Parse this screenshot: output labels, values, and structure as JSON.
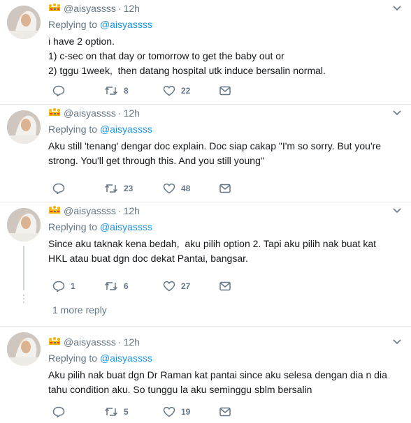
{
  "tweets": [
    {
      "handle": "@aisyassss",
      "time": "12h",
      "replying_prefix": "Replying to",
      "replying_to": "@aisyassss",
      "text": "i have 2 option.\n1) c-sec on that day or tomorrow to get the baby out or\n2) tggu 1week,  then datang hospital utk induce bersalin normal.",
      "replies": "",
      "retweets": "8",
      "likes": "22"
    },
    {
      "handle": "@aisyassss",
      "time": "12h",
      "replying_prefix": "Replying to",
      "replying_to": "@aisyassss",
      "text": "Aku still 'tenang' dengar doc explain. Doc siap cakap \"I'm so sorry. But you're strong. You'll get through this. And you still young\"",
      "replies": "",
      "retweets": "23",
      "likes": "48"
    },
    {
      "handle": "@aisyassss",
      "time": "12h",
      "replying_prefix": "Replying to",
      "replying_to": "@aisyassss",
      "text": "Since aku taknak kena bedah,  aku pilih option 2. Tapi aku pilih nak buat kat HKL atau buat dgn doc dekat Pantai, bangsar.",
      "replies": "1",
      "retweets": "6",
      "likes": "27",
      "more_replies": "1 more reply"
    },
    {
      "handle": "@aisyassss",
      "time": "12h",
      "replying_prefix": "Replying to",
      "replying_to": "@aisyassss",
      "text": "Aku pilih nak buat dgn Dr Raman kat pantai since aku selesa dengan dia n dia tahu condition aku. So tunggu la aku seminggu sblm bersalin",
      "replies": "",
      "retweets": "5",
      "likes": "19"
    }
  ],
  "colors": {
    "muted": "#657786",
    "link": "#1b95e0",
    "text": "#14171a",
    "divider": "#e6ecf0",
    "crown": "#f4b400"
  },
  "icons": [
    "avatar",
    "crown-emoji-icon",
    "caret-down-icon",
    "reply-icon",
    "retweet-icon",
    "like-icon",
    "direct-message-icon"
  ]
}
